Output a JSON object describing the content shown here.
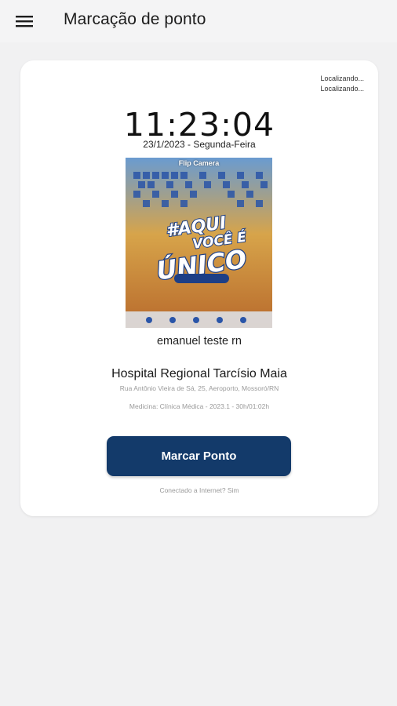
{
  "appbar": {
    "title": "Marcação de ponto",
    "menu_icon": "hamburger-menu-icon"
  },
  "location": {
    "line1": "Localizando...",
    "line2": "Localizando..."
  },
  "clock": {
    "time": "11:23:04",
    "date": "23/1/2023 - Segunda-Feira"
  },
  "camera": {
    "flip_label": "Flip Camera"
  },
  "employee": {
    "name": "emanuel teste rn"
  },
  "workplace": {
    "name": "Hospital Regional Tarcísio Maia",
    "address": "Rua Antônio Vieira de Sá, 25, Aeroporto, Mossoró/RN",
    "shift": "Medicina: Clínica Médica - 2023.1 - 30h/01:02h"
  },
  "action": {
    "button_label": "Marcar Ponto"
  },
  "status": {
    "connection": "Conectado a Internet? Sim"
  },
  "colors": {
    "primary": "#133a6a",
    "background": "#f1f1f2",
    "card": "#ffffff"
  }
}
